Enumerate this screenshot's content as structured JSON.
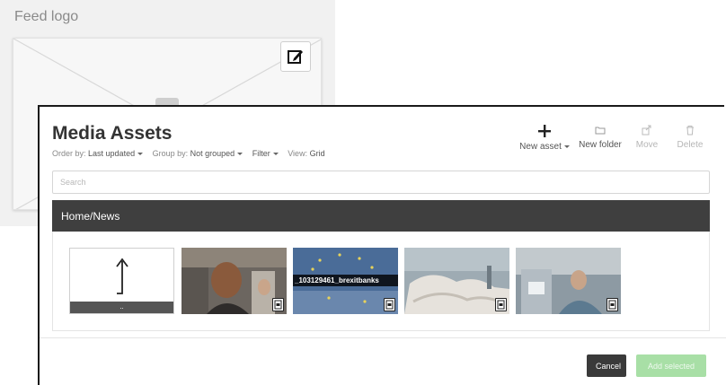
{
  "background": {
    "title": "Feed logo"
  },
  "modal": {
    "title": "Media Assets",
    "order_by_label": "Order by:",
    "order_by_value": "Last updated",
    "group_by_label": "Group by:",
    "group_by_value": "Not grouped",
    "filter_label": "Filter",
    "view_label": "View:",
    "view_value": "Grid",
    "toolbar": {
      "new_asset": "New asset",
      "new_folder": "New folder",
      "move": "Move",
      "delete": "Delete"
    },
    "search_placeholder": "Search",
    "path": "Home/News",
    "tiles": [
      {
        "kind": "parent-folder",
        "label": ".."
      },
      {
        "kind": "image",
        "caption": ""
      },
      {
        "kind": "image",
        "caption": "_103129461_brexitbanks"
      },
      {
        "kind": "image",
        "caption": ""
      },
      {
        "kind": "image",
        "caption": ""
      }
    ],
    "cancel_label": "Cancel",
    "add_selected_label": "Add selected"
  },
  "colors": {
    "path_bar": "#3f3f3f",
    "cancel_button": "#3a3a3a",
    "add_selected_button": "#a8dfa6"
  }
}
